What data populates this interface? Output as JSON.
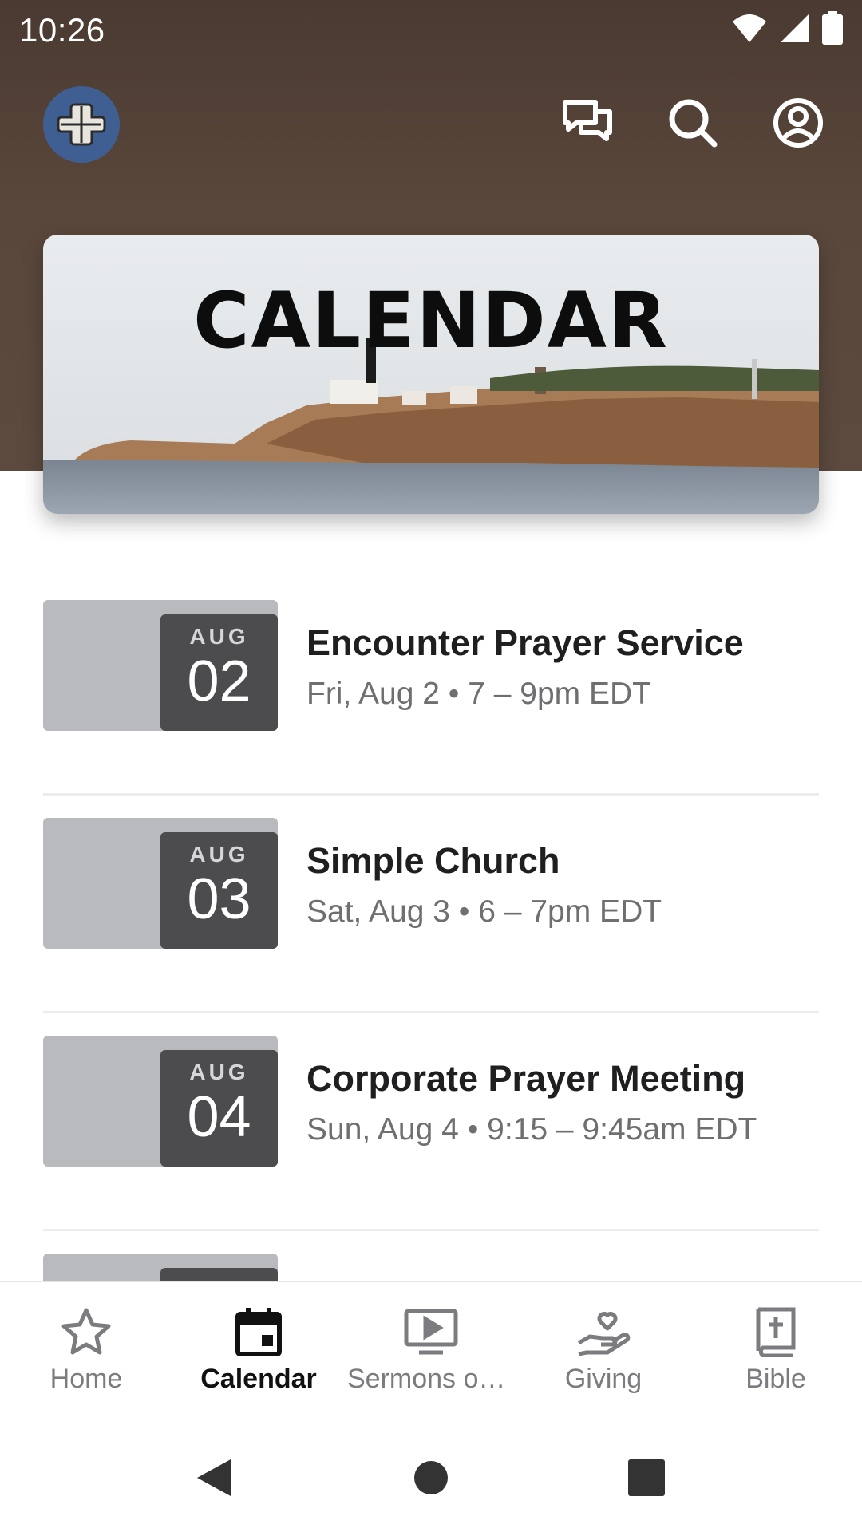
{
  "status_bar": {
    "time": "10:26"
  },
  "banner": {
    "title": "CALENDAR"
  },
  "events": [
    {
      "month": "AUG",
      "day": "02",
      "title": "Encounter Prayer Service",
      "when": "Fri, Aug 2 • 7 – 9pm EDT"
    },
    {
      "month": "AUG",
      "day": "03",
      "title": "Simple Church",
      "when": "Sat, Aug 3 • 6 – 7pm EDT"
    },
    {
      "month": "AUG",
      "day": "04",
      "title": "Corporate Prayer Meeting",
      "when": "Sun, Aug 4 • 9:15 – 9:45am EDT"
    }
  ],
  "nav": [
    {
      "label": "Home",
      "icon": "star-icon"
    },
    {
      "label": "Calendar",
      "icon": "calendar-icon",
      "active": true
    },
    {
      "label": "Sermons on Demand",
      "icon": "video-icon"
    },
    {
      "label": "Giving",
      "icon": "giving-icon"
    },
    {
      "label": "Bible",
      "icon": "bible-icon"
    }
  ],
  "colors": {
    "header_brown": "#5a473b",
    "logo_blue": "#3f5f93",
    "date_block": "#4c4c4f",
    "thumb_gray": "#b9babd"
  }
}
